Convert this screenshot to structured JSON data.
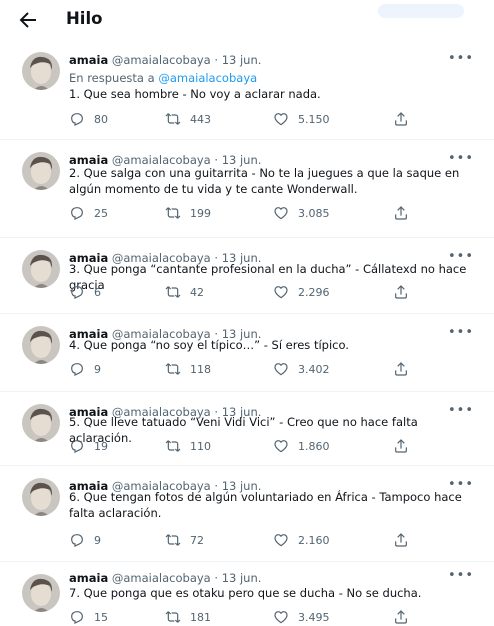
{
  "header": {
    "title": "Hilo"
  },
  "tweets": [
    {
      "name": "amaia",
      "handle": "@amaialacobaya",
      "sep": "·",
      "date": "13 jun.",
      "reply_prefix": "En respuesta a ",
      "reply_handle": "@amaialacobaya",
      "text": "1. Que sea hombre - No voy a aclarar nada.",
      "replies": "80",
      "retweets": "443",
      "likes": "5.150"
    },
    {
      "name": "amaia",
      "handle": "@amaialacobaya",
      "sep": "·",
      "date": "13 jun.",
      "text": "2. Que salga con una guitarrita - No te la juegues a que la saque en algún momento de tu vida y te cante Wonderwall.",
      "replies": "25",
      "retweets": "199",
      "likes": "3.085"
    },
    {
      "name": "amaia",
      "handle": "@amaialacobaya",
      "sep": "·",
      "date": "13 jun.",
      "text": "3. Que ponga “cantante profesional en la ducha” - Cállatexd no hace gracia",
      "replies": "6",
      "retweets": "42",
      "likes": "2.296"
    },
    {
      "name": "amaia",
      "handle": "@amaialacobaya",
      "sep": "·",
      "date": "13 jun.",
      "text": "4. Que ponga “no soy el típico…” - Sí eres típico.",
      "replies": "9",
      "retweets": "118",
      "likes": "3.402"
    },
    {
      "name": "amaia",
      "handle": "@amaialacobaya",
      "sep": "·",
      "date": "13 jun.",
      "text": "5. Que lleve tatuado “Veni Vidi Vici” - Creo que no hace falta aclaración.",
      "replies": "19",
      "retweets": "110",
      "likes": "1.860"
    },
    {
      "name": "amaia",
      "handle": "@amaialacobaya",
      "sep": "·",
      "date": "13 jun.",
      "text": "6. Que tengan fotos de algún voluntariado en África - Tampoco hace falta aclaración.",
      "replies": "9",
      "retweets": "72",
      "likes": "2.160"
    },
    {
      "name": "amaia",
      "handle": "@amaialacobaya",
      "sep": "·",
      "date": "13 jun.",
      "text": "7. Que ponga que es otaku pero que se ducha - No se ducha.",
      "replies": "15",
      "retweets": "181",
      "likes": "3.495"
    }
  ]
}
